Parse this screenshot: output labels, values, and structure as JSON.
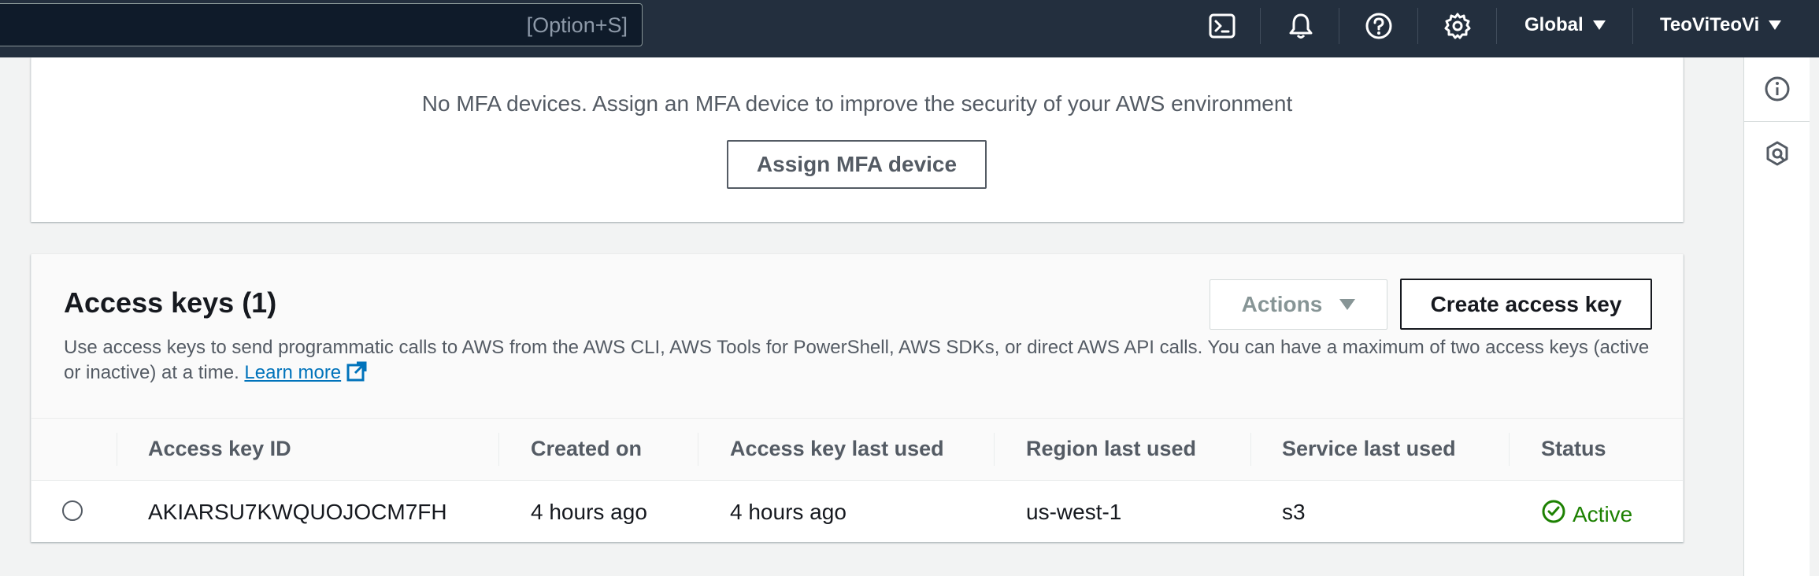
{
  "topbar": {
    "search_shortcut": "[Option+S]",
    "icons": [
      "cloudshell-icon",
      "bell-icon",
      "help-icon",
      "gear-icon"
    ],
    "region": "Global",
    "account": "TeoViTeoVi"
  },
  "mfa": {
    "message": "No MFA devices. Assign an MFA device to improve the security of your AWS environment",
    "assign_button": "Assign MFA device"
  },
  "access_keys": {
    "title": "Access keys (1)",
    "actions_button": "Actions",
    "create_button": "Create access key",
    "description": "Use access keys to send programmatic calls to AWS from the AWS CLI, AWS Tools for PowerShell, AWS SDKs, or direct AWS API calls. You can have a maximum of two access keys (active or inactive) at a time.",
    "learn_more": "Learn more",
    "columns": {
      "key_id": "Access key ID",
      "created_on": "Created on",
      "last_used": "Access key last used",
      "region": "Region last used",
      "service": "Service last used",
      "status": "Status"
    },
    "rows": [
      {
        "key_id": "AKIARSU7KWQUOJOCM7FH",
        "created_on": "4 hours ago",
        "last_used": "4 hours ago",
        "region": "us-west-1",
        "service": "s3",
        "status": "Active"
      }
    ]
  },
  "colors": {
    "nav_bg": "#232f3e",
    "link": "#0073bb",
    "status_active": "#1d8102"
  }
}
